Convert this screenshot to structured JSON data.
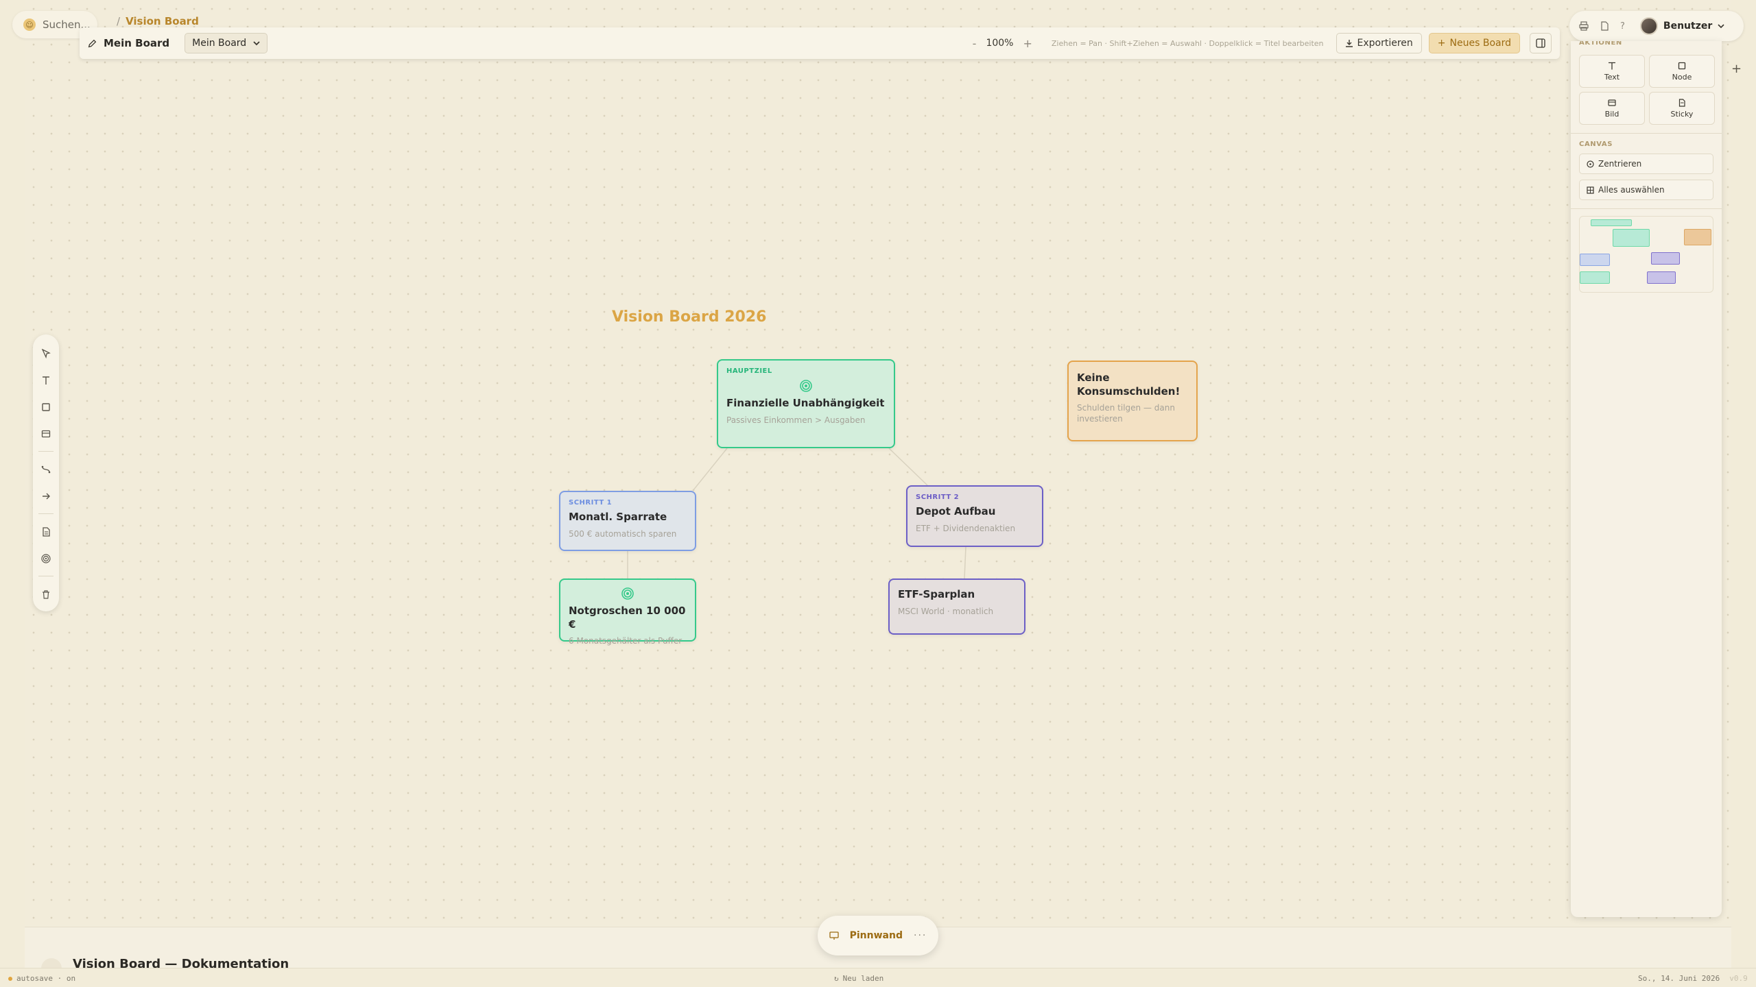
{
  "search": {
    "placeholder": "Suchen..."
  },
  "breadcrumb": {
    "separator": "/",
    "current": "Vision Board"
  },
  "toolbar": {
    "board_name": "Mein Board",
    "board_select": "Mein Board",
    "zoom": "100%",
    "zoom_out": "-",
    "zoom_in": "+",
    "hint": "Ziehen = Pan · Shift+Ziehen = Auswahl · Doppelklick = Titel bearbeiten",
    "export_label": "Exportieren",
    "new_board_label": "Neues Board"
  },
  "board": {
    "title": "Vision Board 2026",
    "nodes": {
      "main": {
        "kicker": "HAUPTZIEL",
        "title": "Finanzielle Unabhängigkeit",
        "sub": "Passives Einkommen > Ausgaben"
      },
      "step1": {
        "kicker": "SCHRITT 1",
        "title": "Monatl. Sparrate",
        "sub": "500 € automatisch sparen"
      },
      "step2": {
        "kicker": "SCHRITT 2",
        "title": "Depot Aufbau",
        "sub": "ETF + Dividendenaktien"
      },
      "emergency": {
        "title": "Notgroschen 10 000 €",
        "sub": "6 Monatsgehälter als Puffer"
      },
      "etf": {
        "title": "ETF-Sparplan",
        "sub": "MSCI World · monatlich"
      },
      "debt": {
        "title": "Keine Konsumschulden!",
        "sub": "Schulden tilgen — dann investieren"
      }
    }
  },
  "user": {
    "name": "Benutzer"
  },
  "right_panel": {
    "actions_label": "AKTIONEN",
    "tiles": [
      {
        "label": "Text",
        "icon": "text-icon"
      },
      {
        "label": "Node",
        "icon": "square-icon"
      },
      {
        "label": "Bild",
        "icon": "image-icon"
      },
      {
        "label": "Sticky",
        "icon": "sticky-icon"
      }
    ],
    "canvas_label": "CANVAS",
    "center_label": "Zentrieren",
    "select_all_label": "Alles auswählen"
  },
  "bottom": {
    "doc_title": "Vision Board — Dokumentation",
    "pinnwand_label": "Pinnwand",
    "more": "···"
  },
  "statusbar": {
    "autosave": "autosave · on",
    "reload": "Neu laden",
    "date": "So., 14. Juni 2026",
    "version": "v0.9"
  },
  "colors": {
    "accent": "#dba545",
    "green": "#35c98a",
    "blue": "#7e9de3",
    "purple": "#6c5fc6",
    "orange": "#e4a44c"
  }
}
